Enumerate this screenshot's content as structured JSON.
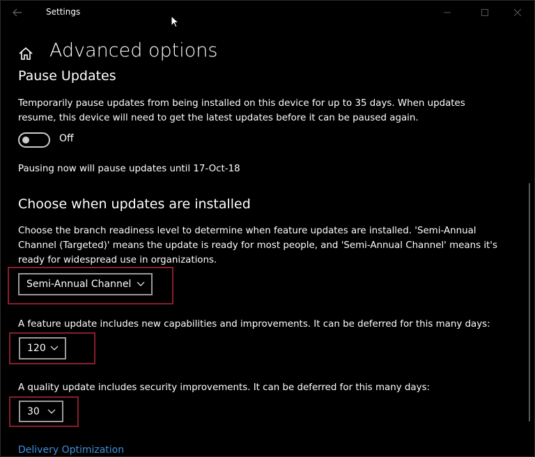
{
  "window": {
    "title": "Settings"
  },
  "header": {
    "title": "Advanced options"
  },
  "pause_updates": {
    "heading": "Pause Updates",
    "description_line1": "Temporarily pause updates from being installed on this device for up to 35 days. When updates",
    "description_line2": "resume, this device will need to get the latest updates before it can be paused again.",
    "toggle_state": "Off",
    "note": "Pausing now will pause updates until 17-Oct-18"
  },
  "choose_updates": {
    "heading": "Choose when updates are installed",
    "description_line1": "Choose the branch readiness level to determine when feature updates are installed. 'Semi-Annual",
    "description_line2": "Channel (Targeted)' means the update is ready for most people, and 'Semi-Annual Channel' means it's",
    "description_line3": "ready for widespread use in organizations.",
    "branch_value": "Semi-Annual Channel",
    "feature_label": "A feature update includes new capabilities and improvements. It can be deferred for this many days:",
    "feature_value": "120",
    "quality_label": "A quality update includes security improvements. It can be deferred for this many days:",
    "quality_value": "30"
  },
  "links": {
    "delivery_optimization": "Delivery Optimization"
  },
  "colors": {
    "background": "#000000",
    "text": "#ffffff",
    "link": "#3f8fdc",
    "highlight_border": "#8a1e2e",
    "control_border": "#9b9b9b"
  },
  "icons": {
    "back": "back-arrow-icon",
    "home": "home-icon",
    "minimize": "minimize-icon",
    "maximize": "maximize-icon",
    "close": "close-icon",
    "dropdown": "chevron-down-icon",
    "cursor": "mouse-cursor-icon"
  }
}
